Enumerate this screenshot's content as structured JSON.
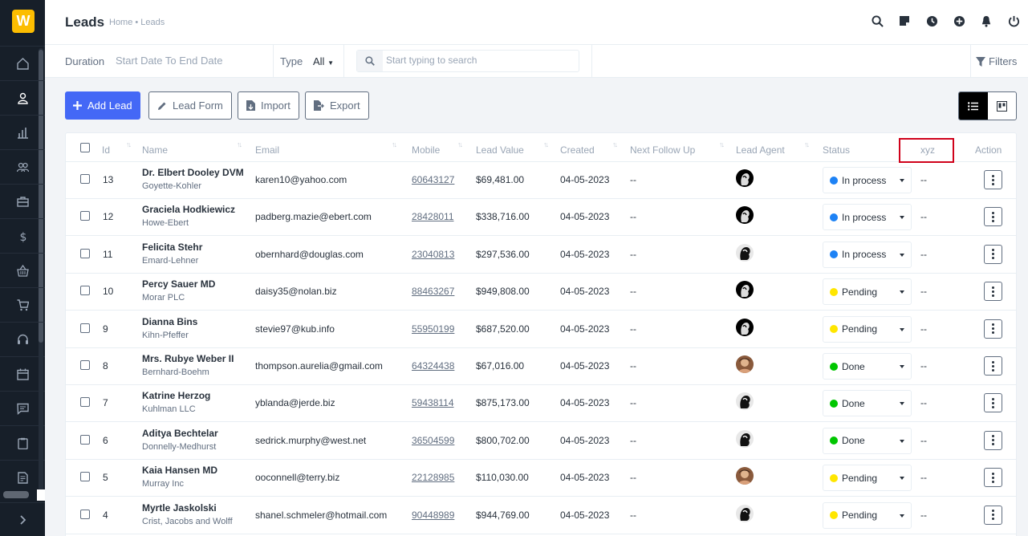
{
  "app": {
    "logo_letter": "W"
  },
  "header": {
    "title": "Leads",
    "breadcrumb": "Home • Leads"
  },
  "top_icons": [
    "search-icon",
    "sticky-note-icon",
    "clock-icon",
    "plus-circle-icon",
    "bell-icon",
    "power-icon"
  ],
  "sidebar": {
    "items": [
      "home-icon",
      "user-icon",
      "chart-icon",
      "users-icon",
      "briefcase-icon",
      "dollar-icon",
      "basket-icon",
      "cart-icon",
      "headset-icon",
      "calendar-icon",
      "message-icon",
      "clipboard-icon",
      "document-icon"
    ],
    "expand_icon": "chevron-right-icon"
  },
  "filters": {
    "duration_label": "Duration",
    "duration_value": "Start Date To End Date",
    "type_label": "Type",
    "type_value": "All",
    "search_placeholder": "Start typing to search",
    "filters_label": "Filters"
  },
  "actions": {
    "add_lead": "Add Lead",
    "lead_form": "Lead Form",
    "import": "Import",
    "export": "Export"
  },
  "columns": {
    "id": "Id",
    "name": "Name",
    "email": "Email",
    "mobile": "Mobile",
    "lead_value": "Lead Value",
    "created": "Created",
    "next_follow_up": "Next Follow Up",
    "lead_agent": "Lead Agent",
    "status": "Status",
    "xyz": "xyz",
    "action": "Action"
  },
  "colors": {
    "accent": "#4468f6",
    "in_process": "#1d82f5",
    "pending": "#ffe600",
    "done": "#00c600",
    "highlight_box": "#d0021b"
  },
  "rows": [
    {
      "id": "13",
      "name": "Dr. Elbert Dooley DVM",
      "company": "Goyette-Kohler",
      "email": "karen10@yahoo.com",
      "mobile": "60643127",
      "value": "$69,481.00",
      "created": "04-05-2023",
      "follow": "--",
      "agent": "dark",
      "status": "In process",
      "xyz": "--"
    },
    {
      "id": "12",
      "name": "Graciela Hodkiewicz",
      "company": "Howe-Ebert",
      "email": "padberg.mazie@ebert.com",
      "mobile": "28428011",
      "value": "$338,716.00",
      "created": "04-05-2023",
      "follow": "--",
      "agent": "dark",
      "status": "In process",
      "xyz": "--"
    },
    {
      "id": "11",
      "name": "Felicita Stehr",
      "company": "Emard-Lehner",
      "email": "obernhard@douglas.com",
      "mobile": "23040813",
      "value": "$297,536.00",
      "created": "04-05-2023",
      "follow": "--",
      "agent": "light",
      "status": "In process",
      "xyz": "--"
    },
    {
      "id": "10",
      "name": "Percy Sauer MD",
      "company": "Morar PLC",
      "email": "daisy35@nolan.biz",
      "mobile": "88463267",
      "value": "$949,808.00",
      "created": "04-05-2023",
      "follow": "--",
      "agent": "dark",
      "status": "Pending",
      "xyz": "--"
    },
    {
      "id": "9",
      "name": "Dianna Bins",
      "company": "Kihn-Pfeffer",
      "email": "stevie97@kub.info",
      "mobile": "55950199",
      "value": "$687,520.00",
      "created": "04-05-2023",
      "follow": "--",
      "agent": "dark",
      "status": "Pending",
      "xyz": "--"
    },
    {
      "id": "8",
      "name": "Mrs. Rubye Weber II",
      "company": "Bernhard-Boehm",
      "email": "thompson.aurelia@gmail.com",
      "mobile": "64324438",
      "value": "$67,016.00",
      "created": "04-05-2023",
      "follow": "--",
      "agent": "photo",
      "status": "Done",
      "xyz": "--"
    },
    {
      "id": "7",
      "name": "Katrine Herzog",
      "company": "Kuhlman LLC",
      "email": "yblanda@jerde.biz",
      "mobile": "59438114",
      "value": "$875,173.00",
      "created": "04-05-2023",
      "follow": "--",
      "agent": "light",
      "status": "Done",
      "xyz": "--"
    },
    {
      "id": "6",
      "name": "Aditya Bechtelar",
      "company": "Donnelly-Medhurst",
      "email": "sedrick.murphy@west.net",
      "mobile": "36504599",
      "value": "$800,702.00",
      "created": "04-05-2023",
      "follow": "--",
      "agent": "light",
      "status": "Done",
      "xyz": "--"
    },
    {
      "id": "5",
      "name": "Kaia Hansen MD",
      "company": "Murray Inc",
      "email": "ooconnell@terry.biz",
      "mobile": "22128985",
      "value": "$110,030.00",
      "created": "04-05-2023",
      "follow": "--",
      "agent": "photo",
      "status": "Pending",
      "xyz": "--"
    },
    {
      "id": "4",
      "name": "Myrtle Jaskolski",
      "company": "Crist, Jacobs and Wolff",
      "email": "shanel.schmeler@hotmail.com",
      "mobile": "90448989",
      "value": "$944,769.00",
      "created": "04-05-2023",
      "follow": "--",
      "agent": "light",
      "status": "Pending",
      "xyz": "--"
    }
  ]
}
